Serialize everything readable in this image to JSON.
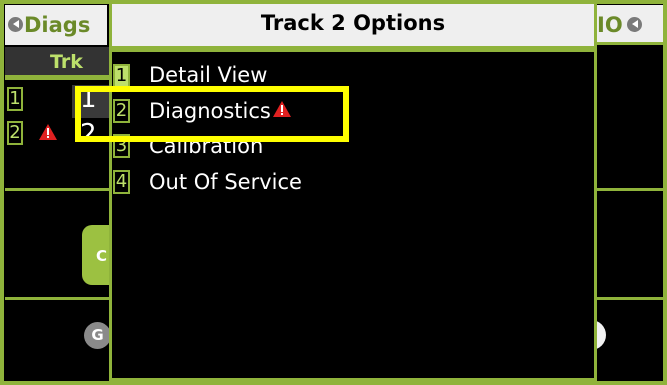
{
  "background_panel": {
    "left_title": "Diags",
    "right_title": "IO",
    "column_header": "Trk",
    "tracks": [
      {
        "key": "1",
        "value": "1",
        "selected": true,
        "warning": false
      },
      {
        "key": "2",
        "value": "2",
        "selected": false,
        "warning": true
      }
    ],
    "c_button": "C",
    "g_button": "G"
  },
  "dialog": {
    "title": "Track 2 Options",
    "options": [
      {
        "key": "1",
        "label": "Detail View",
        "selected": true
      },
      {
        "key": "2",
        "label": "Diagnostics",
        "warning": true
      },
      {
        "key": "3",
        "label": "Calibration"
      },
      {
        "key": "4",
        "label": "Out Of Service"
      }
    ]
  },
  "colors": {
    "accent_green": "#8fb33b",
    "light_green": "#bde06b",
    "highlight_yellow": "#ffff00",
    "warning_red": "#e02020"
  },
  "icons": {
    "back": "left-arrow-circle-icon",
    "warning": "warning-triangle-icon"
  }
}
